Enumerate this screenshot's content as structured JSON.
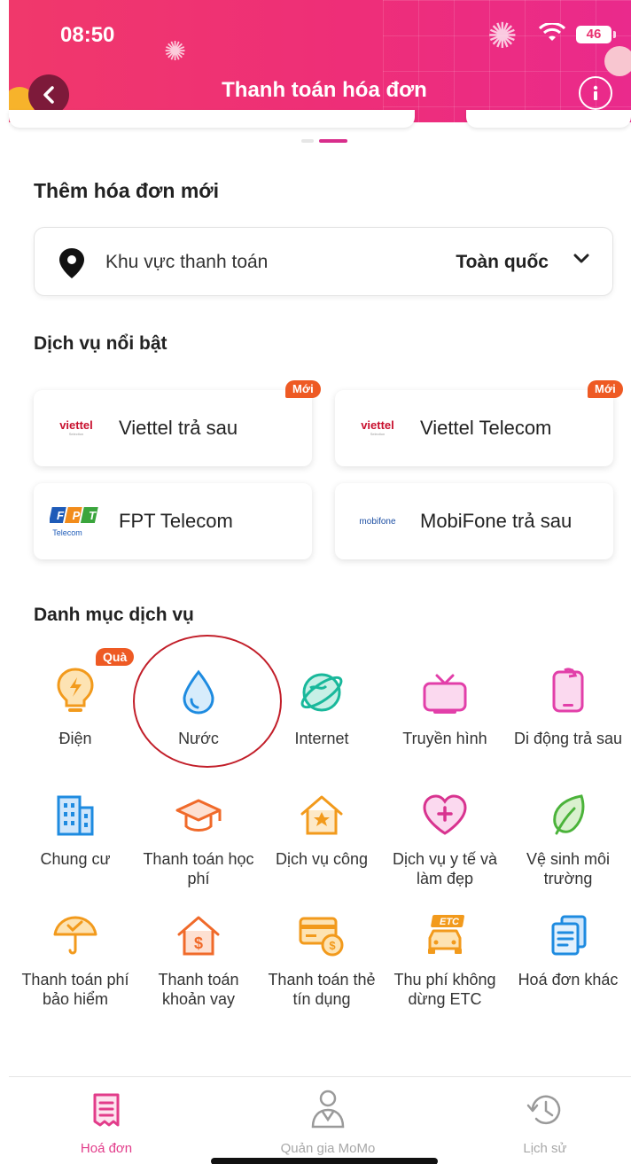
{
  "status_bar": {
    "time": "08:50",
    "battery": "46"
  },
  "header": {
    "title": "Thanh toán hóa đơn",
    "back_icon": "chevron-left-icon",
    "info_icon": "info-icon"
  },
  "colors": {
    "brand": "#ea2e78",
    "accent_magenta": "#d82d8b",
    "icon_orange": "#f29a1c",
    "icon_blue": "#1e8be0",
    "icon_teal": "#19b89b",
    "badge_orange": "#ee5a24"
  },
  "add_bill": {
    "title": "Thêm hóa đơn mới",
    "area_label": "Khu vực thanh toán",
    "area_value": "Toàn quốc"
  },
  "featured": {
    "title": "Dịch vụ nổi bật",
    "items": [
      {
        "name": "Viettel trả sau",
        "badge": "Mới",
        "logo": "viettel"
      },
      {
        "name": "Viettel Telecom",
        "badge": "Mới",
        "logo": "viettel"
      },
      {
        "name": "FPT Telecom",
        "badge": "",
        "logo": "FPT"
      },
      {
        "name": "MobiFone trả sau",
        "badge": "",
        "logo": "mobifone"
      }
    ],
    "logo_sub": {
      "viettel_tag": "Selection",
      "fpt_sub": "Telecom"
    }
  },
  "categories": {
    "title": "Danh mục dịch vụ",
    "gift_badge": "Quà",
    "items": [
      {
        "label": "Điện",
        "icon": "bulb-icon"
      },
      {
        "label": "Nước",
        "icon": "water-drop-icon"
      },
      {
        "label": "Internet",
        "icon": "globe-icon"
      },
      {
        "label": "Truyền hình",
        "icon": "tv-icon"
      },
      {
        "label": "Di động trả sau",
        "icon": "mobile-icon"
      },
      {
        "label": "Chung cư",
        "icon": "building-icon"
      },
      {
        "label": "Thanh toán học phí",
        "icon": "graduation-icon"
      },
      {
        "label": "Dịch vụ công",
        "icon": "public-service-icon"
      },
      {
        "label": "Dịch vụ y tế và làm đẹp",
        "icon": "health-icon"
      },
      {
        "label": "Vệ sinh môi trường",
        "icon": "leaf-icon"
      },
      {
        "label": "Thanh toán phí bảo hiểm",
        "icon": "umbrella-icon"
      },
      {
        "label": "Thanh toán khoản vay",
        "icon": "loan-icon"
      },
      {
        "label": "Thanh toán thẻ tín dụng",
        "icon": "credit-card-icon"
      },
      {
        "label": "Thu phí không dừng ETC",
        "icon": "etc-icon",
        "icon_text": "ETC"
      },
      {
        "label": "Hoá đơn khác",
        "icon": "other-bills-icon"
      }
    ]
  },
  "bottom_nav": [
    {
      "label": "Hoá đơn",
      "icon": "bill-icon",
      "active": true
    },
    {
      "label": "Quản gia MoMo",
      "icon": "butler-icon",
      "active": false
    },
    {
      "label": "Lịch sử",
      "icon": "history-icon",
      "active": false
    }
  ]
}
